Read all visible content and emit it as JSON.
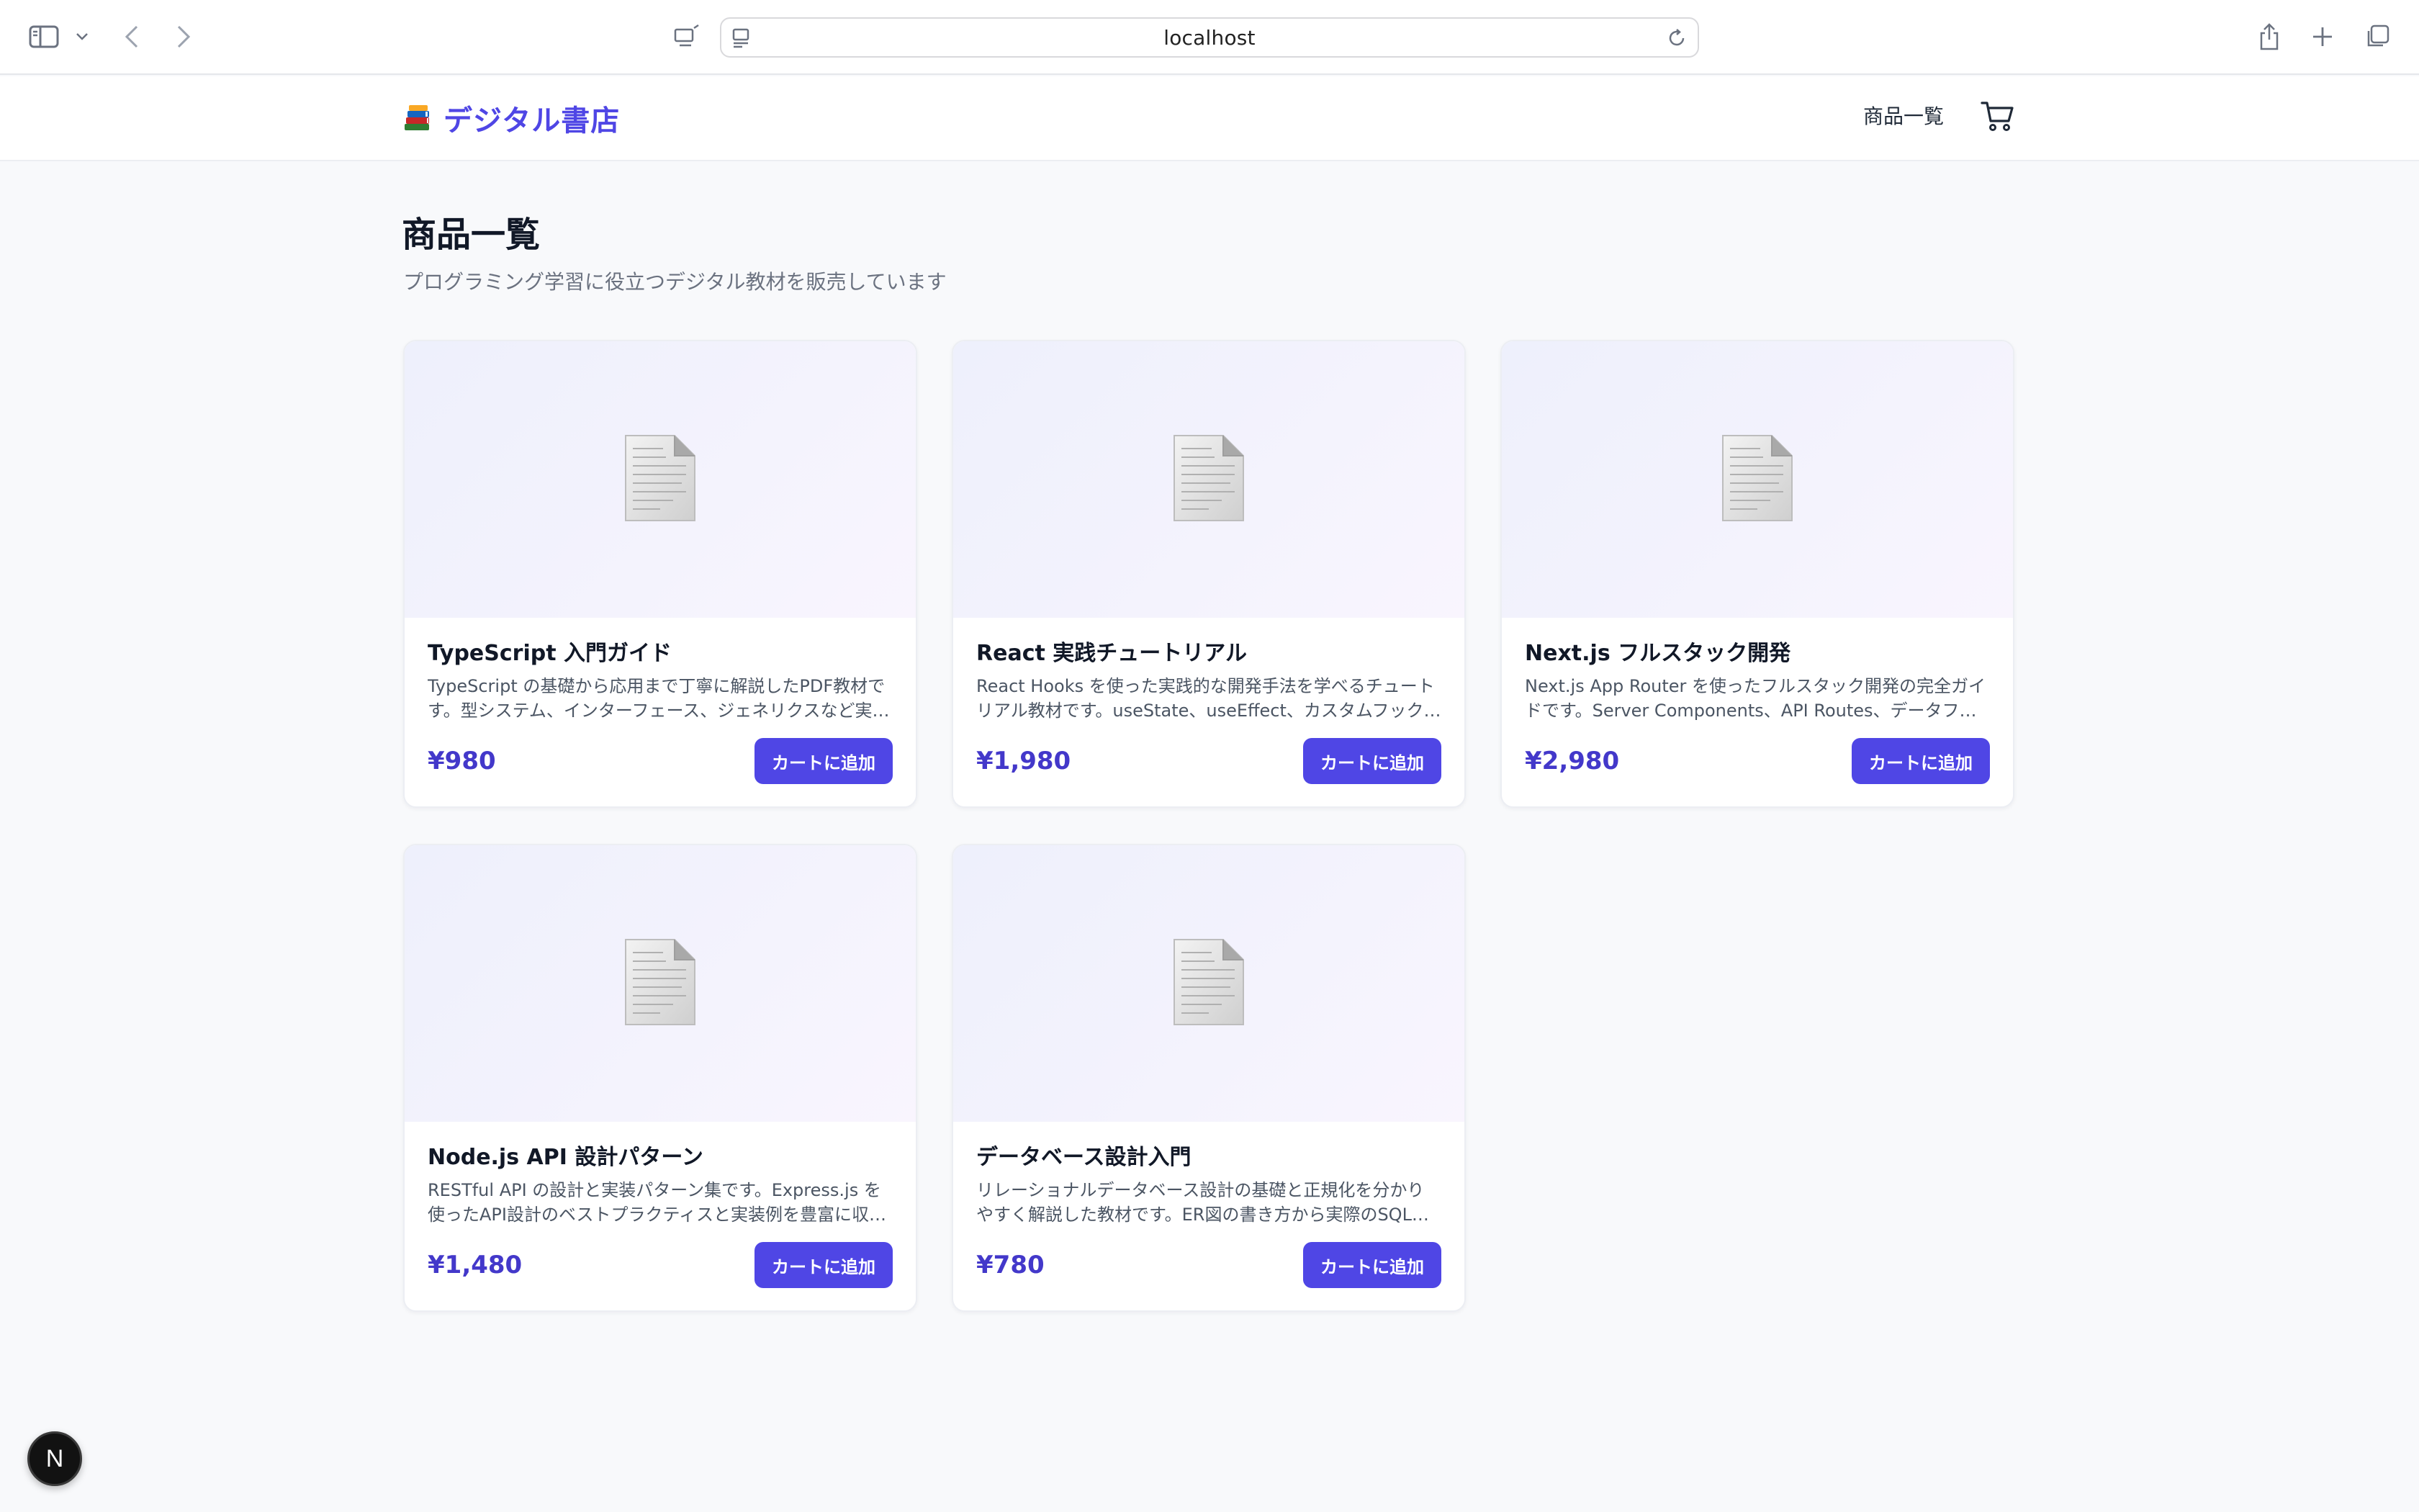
{
  "browser": {
    "url": "localhost"
  },
  "header": {
    "brand": "デジタル書店",
    "nav_products": "商品一覧"
  },
  "main": {
    "title": "商品一覧",
    "subtitle": "プログラミング学習に役立つデジタル教材を販売しています",
    "add_label": "カートに追加"
  },
  "products": [
    {
      "title": "TypeScript 入門ガイド",
      "description": "TypeScript の基礎から応用まで丁寧に解説したPDF教材です。型システム、インターフェース、ジェネリクスなど実…",
      "price": "¥980"
    },
    {
      "title": "React 実践チュートリアル",
      "description": "React Hooks を使った実践的な開発手法を学べるチュートリアル教材です。useState、useEffect、カスタムフック…",
      "price": "¥1,980"
    },
    {
      "title": "Next.js フルスタック開発",
      "description": "Next.js App Router を使ったフルスタック開発の完全ガイドです。Server Components、API Routes、データフェッチ…",
      "price": "¥2,980"
    },
    {
      "title": "Node.js API 設計パターン",
      "description": "RESTful API の設計と実装パターン集です。Express.js を使ったAPI設計のベストプラクティスと実装例を豊富に収録…",
      "price": "¥1,480"
    },
    {
      "title": "データベース設計入門",
      "description": "リレーショナルデータベース設計の基礎と正規化を分かりやすく解説した教材です。ER図の書き方から実際のSQL…",
      "price": "¥780"
    }
  ],
  "dev_badge": "N",
  "colors": {
    "accent": "#4f46e5",
    "price": "#4338ca"
  }
}
